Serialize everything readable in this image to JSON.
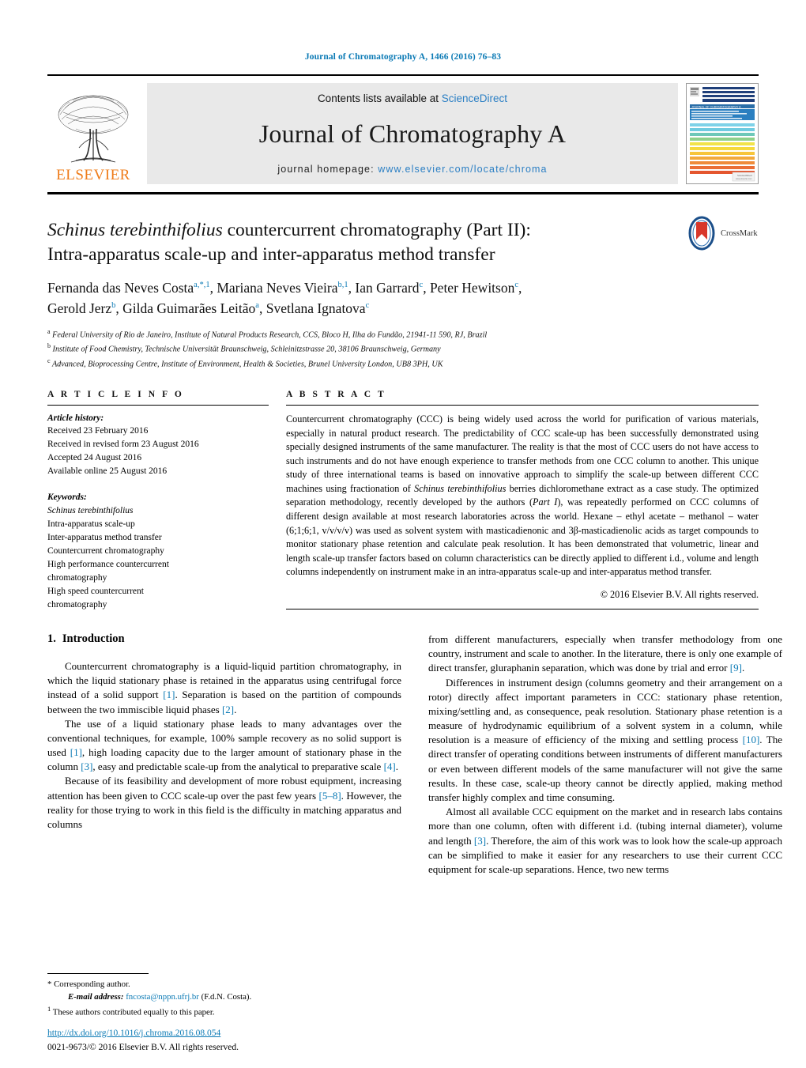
{
  "running_head": "Journal of Chromatography A, 1466 (2016) 76–83",
  "masthead": {
    "contents_prefix": "Contents lists available at ",
    "sciencedirect": "ScienceDirect",
    "journal_title": "Journal of Chromatography A",
    "homepage_prefix": "journal homepage: ",
    "homepage_url": "www.elsevier.com/locate/chroma",
    "publisher": "ELSEVIER",
    "cover_title": "JOURNAL OF CHROMATOGRAPHY A",
    "accent_blue": "#2b7fc4",
    "elsevier_orange": "#ef7c1a",
    "band_gray": "#e9e9e9"
  },
  "crossmark": {
    "label": "CrossMark"
  },
  "title": {
    "italic_part": "Schinus terebinthifolius",
    "rest_line1": " countercurrent chromatography (Part II):",
    "line2": "Intra-apparatus scale-up and inter-apparatus method transfer"
  },
  "authors": [
    {
      "name": "Fernanda das Neves Costa",
      "marks": "a,*,1",
      "sep": ", "
    },
    {
      "name": "Mariana Neves Vieira",
      "marks": "b,1",
      "sep": ", "
    },
    {
      "name": "Ian Garrard",
      "marks": "c",
      "sep": ", "
    },
    {
      "name": "Peter Hewitson",
      "marks": "c",
      "sep": ","
    },
    {
      "name": "Gerold Jerz",
      "marks": "b",
      "sep": ", "
    },
    {
      "name": "Gilda Guimarães Leitão",
      "marks": "a",
      "sep": ", "
    },
    {
      "name": "Svetlana Ignatova",
      "marks": "c",
      "sep": ""
    }
  ],
  "affiliations": [
    {
      "mark": "a",
      "text": "Federal University of Rio de Janeiro, Institute of Natural Products Research, CCS, Bloco H, Ilha do Fundão, 21941-11 590, RJ, Brazil"
    },
    {
      "mark": "b",
      "text": "Institute of Food Chemistry, Technische Universität Braunschweig, Schleinitzstrasse 20, 38106 Braunschweig, Germany"
    },
    {
      "mark": "c",
      "text": "Advanced, Bioprocessing Centre, Institute of Environment, Health & Societies, Brunel University London, UB8 3PH, UK"
    }
  ],
  "article_info": {
    "heading": "A R T I C L E    I N F O",
    "history_label": "Article history:",
    "history": [
      "Received 23 February 2016",
      "Received in revised form 23 August 2016",
      "Accepted 24 August 2016",
      "Available online 25 August 2016"
    ],
    "keywords_label": "Keywords:",
    "keywords": [
      "Schinus terebinthifolius",
      "Intra-apparatus scale-up",
      "Inter-apparatus method transfer",
      "Countercurrent chromatography",
      "High performance countercurrent",
      "chromatography",
      "High speed countercurrent",
      "chromatography"
    ],
    "keywords_italic_index": 0
  },
  "abstract": {
    "heading": "A B S T R A C T",
    "p1": "Countercurrent chromatography (CCC) is being widely used across the world for purification of various materials, especially in natural product research. The predictability of CCC scale-up has been successfully demonstrated using specially designed instruments of the same manufacturer. The reality is that the most of CCC users do not have access to such instruments and do not have enough experience to transfer methods from one CCC column to another. This unique study of three international teams is based on innovative approach to simplify the scale-up between different CCC machines using fractionation of ",
    "italic1": "Schinus terebinthifolius",
    "p2": " berries dichloromethane extract as a case study. The optimized separation methodology, recently developed by the authors (",
    "italic2": "Part I",
    "p3": "), was repeatedly performed on CCC columns of different design available at most research laboratories across the world. Hexane – ethyl acetate – methanol – water (6;1;6;1, v/v/v/v) was used as solvent system with masticadienonic and 3β-masticadienolic acids as target compounds to monitor stationary phase retention and calculate peak resolution. It has been demonstrated that volumetric, linear and length scale-up transfer factors based on column characteristics can be directly applied to different i.d., volume and length columns independently on instrument make in an intra-apparatus scale-up and inter-apparatus method transfer.",
    "copyright": "© 2016 Elsevier B.V. All rights reserved."
  },
  "section": {
    "number": "1.",
    "title": "Introduction"
  },
  "left_column": [
    {
      "text": "Countercurrent chromatography is a liquid-liquid partition chromatography, in which the liquid stationary phase is retained in the apparatus using centrifugal force instead of a solid support [1]. Separation is based on the partition of compounds between the two immiscible liquid phases [2].",
      "refs": [
        "[1]",
        "[2]"
      ]
    },
    {
      "text": "The use of a liquid stationary phase leads to many advantages over the conventional techniques, for example, 100% sample recovery as no solid support is used [1], high loading capacity due to the larger amount of stationary phase in the column [3], easy and predictable scale-up from the analytical to preparative scale [4].",
      "refs": [
        "[1]",
        "[3]",
        "[4]"
      ]
    },
    {
      "text": "Because of its feasibility and development of more robust equipment, increasing attention has been given to CCC scale-up over the past few years [5–8]. However, the reality for those trying to work in this field is the difficulty in matching apparatus and columns",
      "refs": [
        "[5–8]"
      ]
    }
  ],
  "right_column": [
    {
      "text": "from different manufacturers, especially when transfer methodology from one country, instrument and scale to another. In the literature, there is only one example of direct transfer, gluraphanin separation, which was done by trial and error [9].",
      "refs": [
        "[9]"
      ],
      "continued": true
    },
    {
      "text": "Differences in instrument design (columns geometry and their arrangement on a rotor) directly affect important parameters in CCC: stationary phase retention, mixing/settling and, as consequence, peak resolution. Stationary phase retention is a measure of hydrodynamic equilibrium of a solvent system in a column, while resolution is a measure of efficiency of the mixing and settling process [10]. The direct transfer of operating conditions between instruments of different manufacturers or even between different models of the same manufacturer will not give the same results. In these case, scale-up theory cannot be directly applied, making method transfer highly complex and time consuming.",
      "refs": [
        "[10]"
      ]
    },
    {
      "text": "Almost all available CCC equipment on the market and in research labs contains more than one column, often with different i.d. (tubing internal diameter), volume and length [3]. Therefore, the aim of this work was to look how the scale-up approach can be simplified to make it easier for any researchers to use their current CCC equipment for scale-up separations. Hence, two new terms",
      "refs": [
        "[3]"
      ]
    }
  ],
  "footnotes": {
    "star_symbol": "*",
    "star_text": "Corresponding author.",
    "email_label": "E-mail address:",
    "email": "fncosta@nppn.ufrj.br",
    "email_suffix": "(F.d.N. Costa).",
    "note1_mark": "1",
    "note1_text": "These authors contributed equally to this paper."
  },
  "doi": {
    "url": "http://dx.doi.org/10.1016/j.chroma.2016.08.054",
    "issn_line": "0021-9673/© 2016 Elsevier B.V. All rights reserved."
  }
}
